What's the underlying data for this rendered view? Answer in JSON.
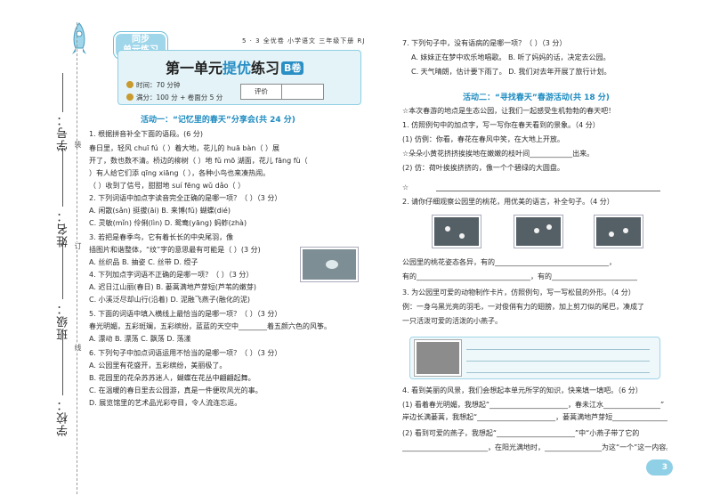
{
  "binding": {
    "school_label": "学校：",
    "class_label": "班级：",
    "name_label": "姓名：",
    "id_label": "学号：",
    "marks": [
      "装",
      "订",
      "线"
    ]
  },
  "header": {
    "banner_line1": "同步",
    "banner_line2": "单元练习",
    "book_meta": "5 · 3 全优卷   小学语文   三年级下册   RJ",
    "title_pre": "第一单元",
    "title_accent": "提优",
    "title_post": "练习",
    "badge": "B卷",
    "time": "时间：70 分钟",
    "score": "满分：100 分 + 卷面分 5 分",
    "eval_label": "评价"
  },
  "left": {
    "heading": "活动一：“记忆里的春天”分享会(共 24 分)",
    "lines": [
      "1. 根据拼音补全下面的语段。(6 分)",
      "    春日里，轻风 chuī fú（        ）着大地，花儿的 huā bàn（        ）展",
      "开了，数也数不清。桥边的柳树（        ）地 fǔ mō 湖面，花儿 fāng fù（",
      "）有人给它们添 qīng xiāng（        ），各种小鸟也来凑热闹。",
      "（        ）收到了信号，甜甜地 suí fēng wǔ dǎo（            ）",
      "2. 下列词语中加点字读音完全正确的是哪一项？（    ）（3 分）",
      "A. 闲散(sǎn)   挺拔(āi)       B. 来博(fǔ)       蝴蝶(dié)",
      "C. 灵敏(mǐn)    伶俐(lìn)      D. 鸳鸯(yāng)     蚂蚱(zhà)",
      "3. 若把是春季鸟，它有着长长的中央尾羽，像",
      "插图片和谐整体，“纹”字的意思最有可能是（    ）(3 分)",
      "A. 丝织品       B. 抽姿        C. 丝带        D. 绶子",
      "4. 下列加点字词语不正确的是哪一项？（    ）（3 分）",
      "A. 迟日江山丽(春日)              B. 蒌蒿满地芦芽短(芦苇的嫩芽)",
      "C. 小溪泛尽却山行(沿着)          D. 泥融飞燕子(融化的泥)",
      "5. 下面的词语中填入横线上最恰当的是哪一项？（    ）（3 分）",
      "春光明媚，五彩斑斓，五彩缤纷，蓝蓝的天空中________着五颜六色的风筝。",
      "A. 漂动        B. 漂荡        C. 飘荡        D. 荡漾",
      "6. 下列句子中加点词语运用不恰当的是哪一项？（    ）（3 分）",
      "A. 公园里有花盛开，五彩缤纷，美丽极了。",
      "B. 花园里的花朵苏苏迷人，蝴蝶在花丛中翩翩起舞。",
      "C. 在温暖的春日里去公园游，真是一件便吹风光的事。",
      "D. 展览馆里的艺术品光彩夺目，令人流连忘返。"
    ]
  },
  "right": {
    "top_lines": [
      "7. 下列句子中，没有语病的是哪一项？（    ）（3 分）",
      "A. 妹妹正在梦中欢乐地唱歌。        B. 听了妈妈的话，决定去公园。",
      "C. 天气晴朗，估计要下雨了。        D. 我们对去年开展了旅行计划。"
    ],
    "heading": "活动二：“寻找春天”春游活动(共 18 分)",
    "lines": [
      "☆本次春游的地点是生态公园，让我们一起感受生机勃勃的春天吧！",
      "1. 仿照例句中的加点字，写一写你在春天看到的景象。（4 分）",
      "(1) 仿例：你看，春花在春风中笑，在大地上开放。",
      "    ☆朵朵小黄花挤挤挨挨地在嫩嫩的枝叶间____________出来。",
      "(2) 仿：荷叶挨挨挤挤的，像一个个碧绿的大圆盘。",
      "☆",
      "2. 请你仔细观察公园里的桃花，用优美的语言，补全句子。（4 分）",
      "    公园里的桃花姿态各异，有的________________________________，",
      "有的________________________________，有的________________________",
      "3. 为公园里可爱的动物制作卡片，仿照例句，写一写松鼠的外形。（4 分）",
      "例：一身乌黑光亮的羽毛，一对俊俏有力的翅膀，加上剪刀似的尾巴，凑成了",
      "一只活泼可爱的活泼的小燕子。",
      "4. 看到美丽的风景，我们会想起本单元所学的知识，快来填一填吧。（6 分）",
      "(1) 看着春光明媚，我想起“______________________，春未江水________________”",
      "    岸边长满蒌蒿，我想起“______________________，蒌蒿满地芦芽短________________”",
      "(2) 看到可爱的燕子，我想起“______________________”中“小燕子带了它的",
      "________________________，在阳光满地时，________________为这“一个”这一内容。"
    ]
  },
  "page_number": "3"
}
